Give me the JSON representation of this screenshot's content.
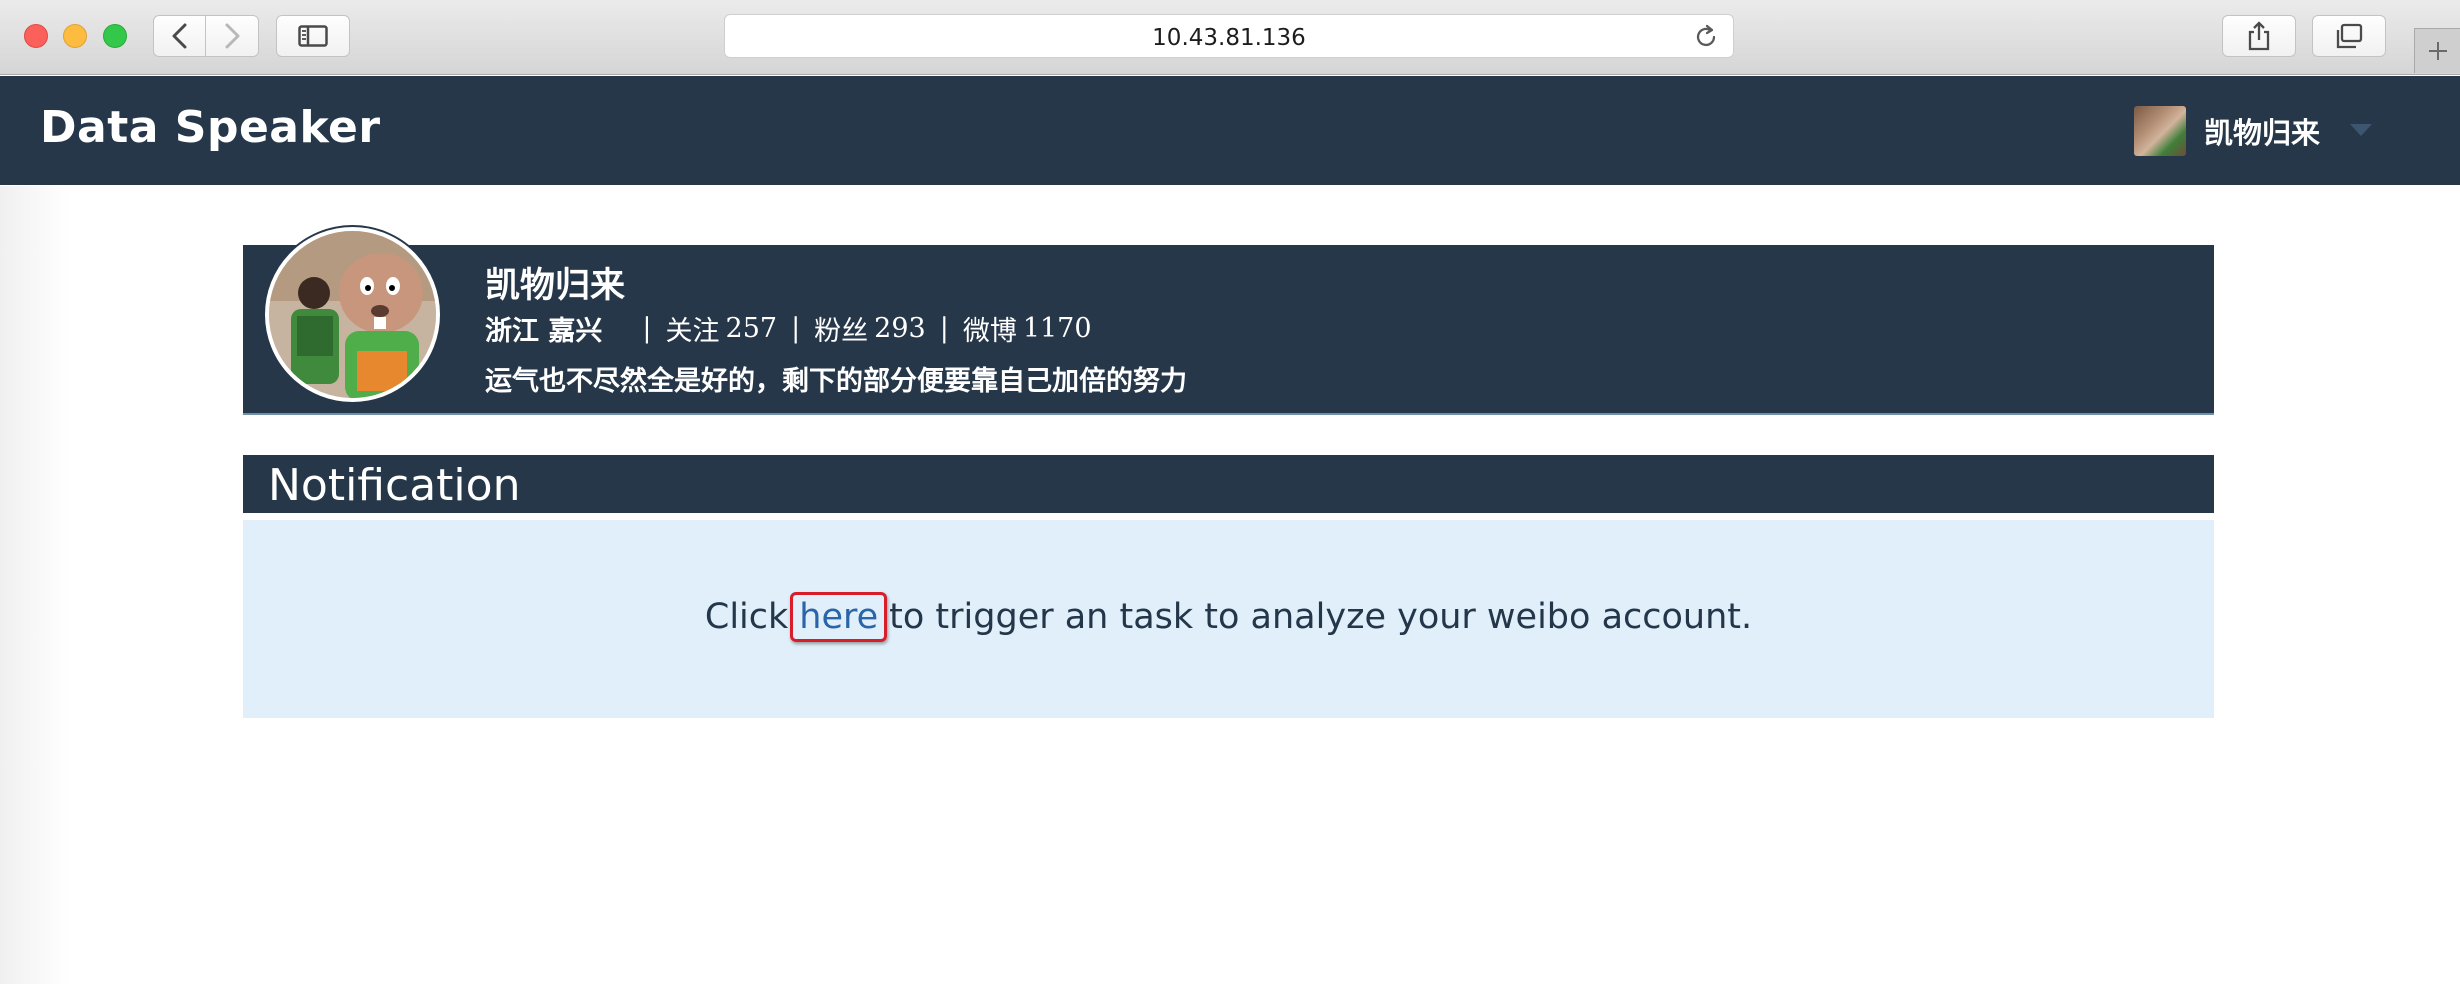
{
  "browser": {
    "address": "10.43.81.136"
  },
  "navbar": {
    "brand": "Data Speaker",
    "username": "凯物归来"
  },
  "profile": {
    "name": "凯物归来",
    "location": "浙江 嘉兴",
    "following_label": "关注",
    "following_count": "257",
    "followers_label": "粉丝",
    "followers_count": "293",
    "weibo_label": "微博",
    "weibo_count": "1170",
    "separator": "|",
    "bio": "运气也不尽然全是好的，剩下的部分便要靠自己加倍的努力"
  },
  "notification": {
    "title": "Notification",
    "message_before": "Click",
    "link_text": "here",
    "message_after": "to trigger an task to analyze your weibo account."
  },
  "colors": {
    "navbar_bg": "#263749",
    "notification_bg": "#e0eff9",
    "link": "#2a64a9",
    "highlight_box": "#d81e2a"
  }
}
